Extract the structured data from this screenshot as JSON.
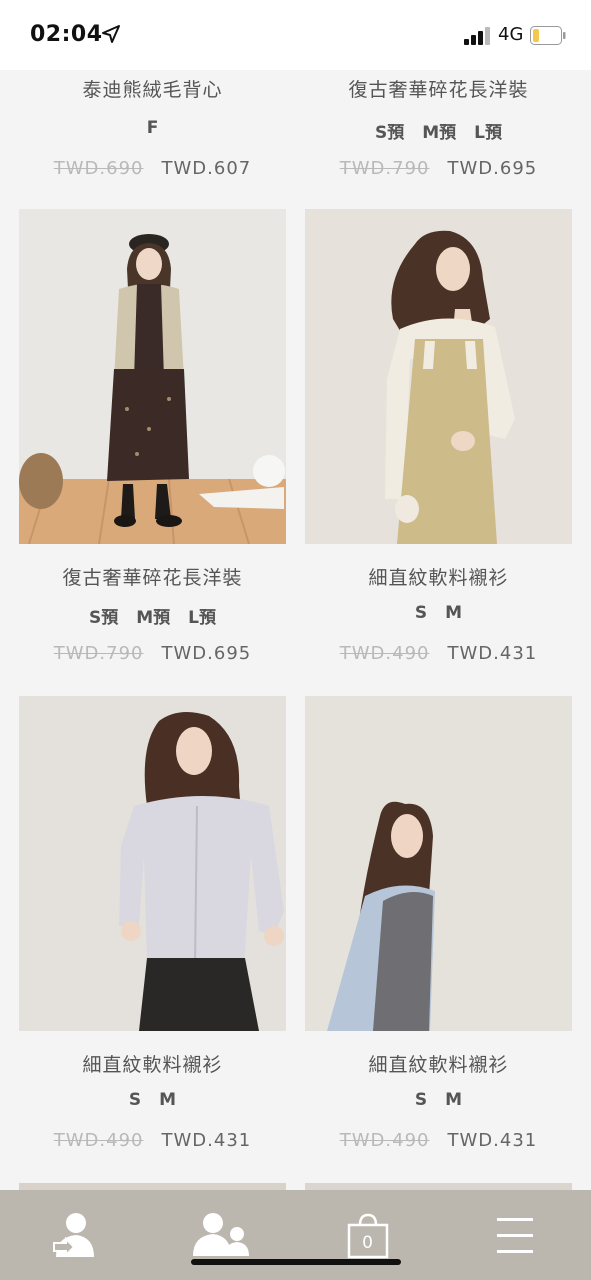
{
  "status": {
    "time": "02:04",
    "network": "4G"
  },
  "top_row": [
    {
      "title": "泰迪熊絨毛背心",
      "sizes": [
        "F"
      ],
      "old_price": "TWD.690",
      "new_price": "TWD.607"
    },
    {
      "title": "復古奢華碎花長洋裝",
      "sizes": [
        "S預",
        "M預",
        "L預"
      ],
      "old_price": "TWD.790",
      "new_price": "TWD.695"
    }
  ],
  "products": [
    {
      "title": "復古奢華碎花長洋裝",
      "sizes": [
        "S預",
        "M預",
        "L預"
      ],
      "old_price": "TWD.790",
      "new_price": "TWD.695",
      "image": "woman-in-floral-dress-with-vest"
    },
    {
      "title": "細直紋軟料襯衫",
      "sizes": [
        "S",
        "M"
      ],
      "old_price": "TWD.490",
      "new_price": "TWD.431",
      "image": "woman-in-khaki-overall-dress"
    },
    {
      "title": "細直紋軟料襯衫",
      "sizes": [
        "S",
        "M"
      ],
      "old_price": "TWD.490",
      "new_price": "TWD.431",
      "image": "woman-in-striped-shirt"
    },
    {
      "title": "細直紋軟料襯衫",
      "sizes": [
        "S",
        "M"
      ],
      "old_price": "TWD.490",
      "new_price": "TWD.431",
      "image": "woman-in-blue-shirt-grey-vest"
    }
  ],
  "nav": {
    "cart_count": "0",
    "items": [
      "member-icon",
      "community-icon",
      "shopping-bag-icon",
      "menu-icon"
    ]
  },
  "colors": {
    "bottom_nav": "#bbb6ae",
    "background": "#f4f4f4",
    "old_price": "#b9b9b9"
  }
}
